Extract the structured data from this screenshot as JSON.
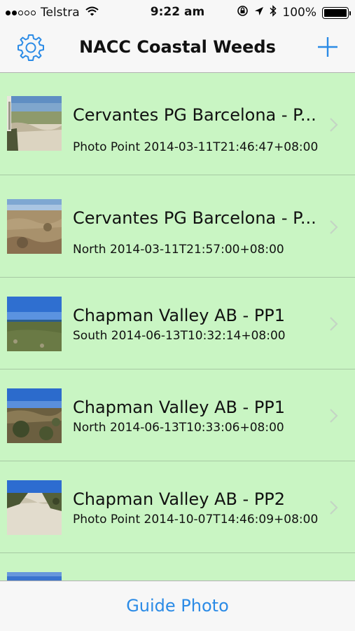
{
  "status_bar": {
    "carrier": "Telstra",
    "time": "9:22 am",
    "battery": "100%",
    "signal_bars_filled": 2,
    "signal_bars_total": 5
  },
  "nav_bar": {
    "title": "NACC Coastal Weeds",
    "left_icon": "gear-icon",
    "right_icon": "plus-icon",
    "accent_color": "#2b8be6"
  },
  "list": {
    "background_color": "#c9f5c3",
    "items": [
      {
        "title": "Cervantes PG Barcelona - P...",
        "subtitle": "Photo Point 2014-03-11T21:46:47+08:00"
      },
      {
        "title": "Cervantes PG Barcelona - P...",
        "subtitle": "North 2014-03-11T21:57:00+08:00"
      },
      {
        "title": "Chapman Valley AB - PP1",
        "subtitle": "South 2014-06-13T10:32:14+08:00"
      },
      {
        "title": "Chapman Valley AB - PP1",
        "subtitle": "North 2014-06-13T10:33:06+08:00"
      },
      {
        "title": "Chapman Valley AB - PP2",
        "subtitle": "Photo Point 2014-10-07T14:46:09+08:00"
      }
    ]
  },
  "toolbar": {
    "guide_photo_label": "Guide Photo"
  }
}
